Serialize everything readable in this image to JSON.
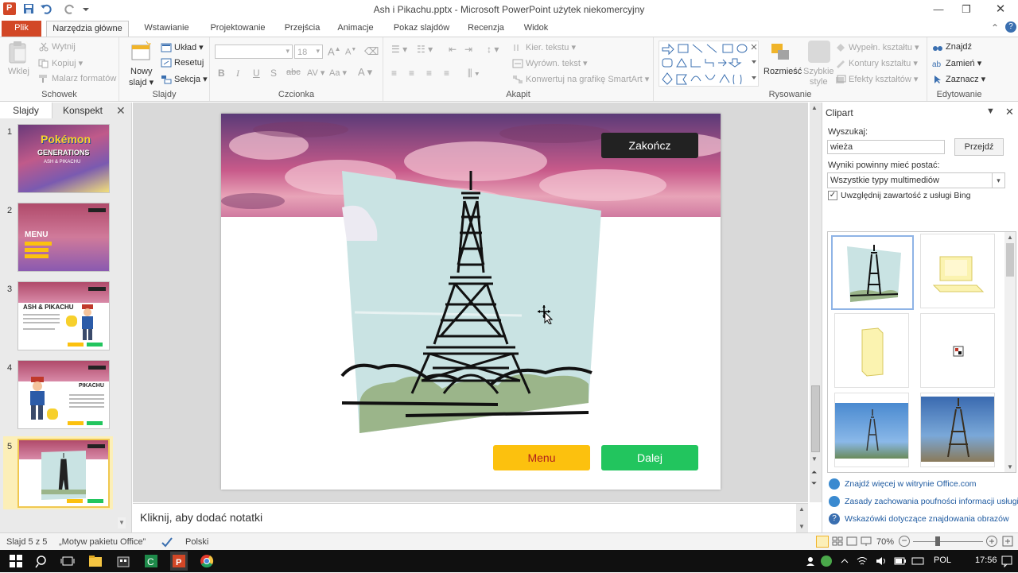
{
  "window": {
    "title": "Ash i Pikachu.pptx - Microsoft PowerPoint użytek niekomercyjny"
  },
  "tabs": [
    {
      "label": "Plik"
    },
    {
      "label": "Narzędzia główne"
    },
    {
      "label": "Wstawianie"
    },
    {
      "label": "Projektowanie"
    },
    {
      "label": "Przejścia"
    },
    {
      "label": "Animacje"
    },
    {
      "label": "Pokaz slajdów"
    },
    {
      "label": "Recenzja"
    },
    {
      "label": "Widok"
    }
  ],
  "ribbon": {
    "clipboard": {
      "label": "Schowek",
      "paste": "Wklej",
      "cut": "Wytnij",
      "copy": "Kopiuj",
      "painter": "Malarz formatów"
    },
    "slides": {
      "label": "Slajdy",
      "new_slide_1": "Nowy",
      "new_slide_2": "slajd",
      "layout": "Układ",
      "reset": "Resetuj",
      "section": "Sekcja"
    },
    "font": {
      "label": "Czcionka",
      "size": "18"
    },
    "paragraph": {
      "label": "Akapit",
      "direction": "Kier. tekstu",
      "align": "Wyrówn. tekst",
      "smartart": "Konwertuj na grafikę SmartArt"
    },
    "drawing": {
      "label": "Rysowanie",
      "arrange": "Rozmieść",
      "quick_styles_1": "Szybkie",
      "quick_styles_2": "style",
      "fill": "Wypełn. kształtu",
      "outline": "Kontury kształtu",
      "effects": "Efekty kształtów"
    },
    "editing": {
      "label": "Edytowanie",
      "find": "Znajdź",
      "replace": "Zamień",
      "select": "Zaznacz"
    }
  },
  "left_panel": {
    "tab_slides": "Slajdy",
    "tab_outline": "Konspekt",
    "slides": [
      {
        "num": "1"
      },
      {
        "num": "2"
      },
      {
        "num": "3"
      },
      {
        "num": "4"
      },
      {
        "num": "5"
      }
    ]
  },
  "thumbs": {
    "t1_title": "Pokémon",
    "t1_sub": "GENERATIONS",
    "t1_line": "ASH & PIKACHU",
    "t2_title": "MENU",
    "t3_title": "ASH & PIKACHU",
    "t4_title": "PIKACHU"
  },
  "slide": {
    "close_button": "Zakończ",
    "menu_button": "Menu",
    "next_button": "Dalej"
  },
  "notes": {
    "placeholder": "Kliknij, aby dodać notatki"
  },
  "clipart": {
    "panel_title": "Clipart",
    "search_label": "Wyszukaj:",
    "search_value": "wieża",
    "search_button": "Przejdź",
    "results_label": "Wyniki powinny mieć postać:",
    "results_value": "Wszystkie typy multimediów",
    "bing_checkbox": "Uwzględnij zawartość z usługi Bing",
    "links": [
      "Znajdź więcej w witrynie Office.com",
      "Zasady zachowania poufności informacji usługi B",
      "Wskazówki dotyczące znajdowania obrazów"
    ]
  },
  "status": {
    "slide_info": "Slajd 5 z 5",
    "theme": "„Motyw pakietu Office”",
    "language": "Polski",
    "zoom": "70%"
  },
  "taskbar": {
    "lang": "POL",
    "time": "17:56"
  },
  "colors": {
    "file_tab": "#d24726",
    "menu_button": "#fcc10e",
    "next_button": "#22c55e",
    "close_button": "#222222"
  }
}
